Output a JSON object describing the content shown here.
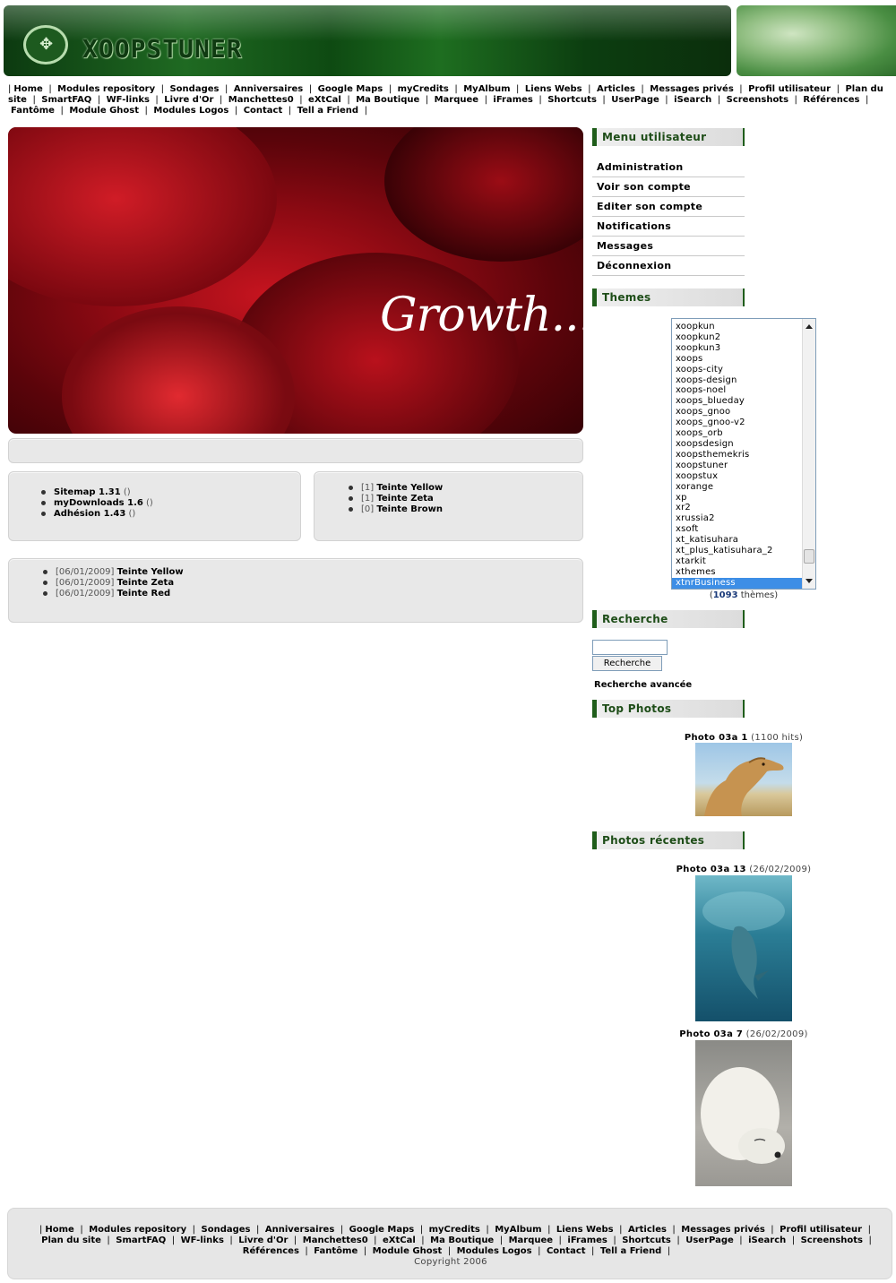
{
  "header": {
    "logo_text": "XOOPSTUNER",
    "logo_emblem": "✥"
  },
  "nav_items": [
    "Home",
    "Modules repository",
    "Sondages",
    "Anniversaires",
    "Google Maps",
    "myCredits",
    "MyAlbum",
    "Liens Webs",
    "Articles",
    "Messages privés",
    "Profil utilisateur",
    "Plan du site",
    "SmartFAQ",
    "WF-links",
    "Livre d'Or",
    "Manchettes0",
    "eXtCal",
    "Ma Boutique",
    "Marquee",
    "iFrames",
    "Shortcuts",
    "UserPage",
    "iSearch",
    "Screenshots",
    "Références",
    "Fantôme",
    "Module Ghost",
    "Modules Logos",
    "Contact",
    "Tell a Friend"
  ],
  "hero": {
    "caption": "Growth..."
  },
  "modules_box": {
    "items": [
      {
        "name": "Sitemap 1.31",
        "extra": "()"
      },
      {
        "name": "myDownloads 1.6",
        "extra": "()"
      },
      {
        "name": "Adhésion 1.43",
        "extra": "()"
      }
    ]
  },
  "themes_box": {
    "items": [
      {
        "count": "[1]",
        "name": "Teinte Yellow"
      },
      {
        "count": "[1]",
        "name": "Teinte Zeta"
      },
      {
        "count": "[0]",
        "name": "Teinte Brown"
      }
    ]
  },
  "news_box": {
    "items": [
      {
        "date": "[06/01/2009]",
        "name": "Teinte Yellow"
      },
      {
        "date": "[06/01/2009]",
        "name": "Teinte Zeta"
      },
      {
        "date": "[06/01/2009]",
        "name": "Teinte Red"
      }
    ]
  },
  "sidebar": {
    "user_menu_title": "Menu utilisateur",
    "user_menu": [
      "Administration",
      "Voir son compte",
      "Editer son compte",
      "Notifications",
      "Messages",
      "Déconnexion"
    ],
    "themes_title": "Themes",
    "themes": [
      "xoopkun",
      "xoopkun2",
      "xoopkun3",
      "xoops",
      "xoops-city",
      "xoops-design",
      "xoops-noel",
      "xoops_blueday",
      "xoops_gnoo",
      "xoops_gnoo-v2",
      "xoops_orb",
      "xoopsdesign",
      "xoopsthemekris",
      "xoopstuner",
      "xoopstux",
      "xorange",
      "xp",
      "xr2",
      "xrussia2",
      "xsoft",
      "xt_katisuhara",
      "xt_plus_katisuhara_2",
      "xtarkit",
      "xthemes",
      "xtnrBusiness"
    ],
    "themes_selected": "xtnrBusiness",
    "themes_count_open": "(",
    "themes_count": "1093",
    "themes_count_suffix": " thèmes)",
    "search_title": "Recherche",
    "search_value": "",
    "search_button": "Recherche",
    "advanced_search": "Recherche avancée",
    "top_photos_title": "Top Photos",
    "top_photo": {
      "title": "Photo 03a 1",
      "meta": "(1100 hits)"
    },
    "recent_photos_title": "Photos récentes",
    "recent_photos": [
      {
        "title": "Photo 03a 13",
        "meta": "(26/02/2009)"
      },
      {
        "title": "Photo 03a 7",
        "meta": "(26/02/2009)"
      }
    ]
  },
  "footer": {
    "nav_items": [
      "Home",
      "Modules repository",
      "Sondages",
      "Anniversaires",
      "Google Maps",
      "myCredits",
      "MyAlbum",
      "Liens Webs",
      "Articles",
      "Messages privés",
      "Profil utilisateur",
      "Plan du site",
      "SmartFAQ",
      "WF-links",
      "Livre d'Or",
      "Manchettes0",
      "eXtCal",
      "Ma Boutique",
      "Marquee",
      "iFrames",
      "Shortcuts",
      "UserPage",
      "iSearch",
      "Screenshots",
      "Références",
      "Fantôme",
      "Module Ghost",
      "Modules Logos",
      "Contact",
      "Tell a Friend"
    ],
    "copyright": "Copyright 2006"
  },
  "colors": {
    "brand_green": "#1f5d1a",
    "hero_red": "#8e0a13",
    "selection_blue": "#3d8ee6"
  }
}
